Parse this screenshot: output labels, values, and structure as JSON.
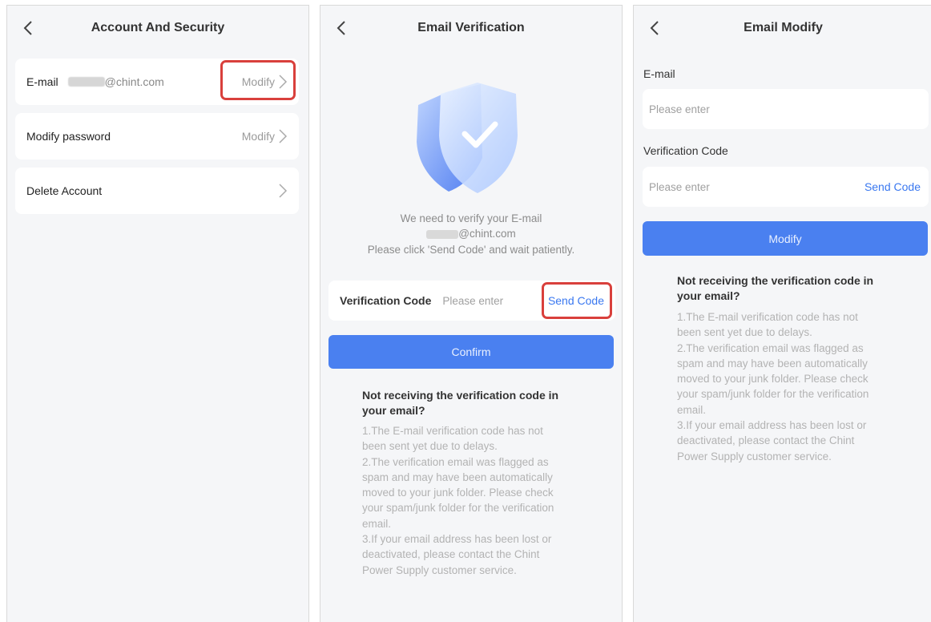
{
  "panel1": {
    "title": "Account And Security",
    "rows": [
      {
        "label": "E-mail",
        "value": "@chint.com",
        "action": "Modify"
      },
      {
        "label": "Modify password",
        "action": "Modify"
      },
      {
        "label": "Delete Account",
        "action": ""
      }
    ]
  },
  "panel2": {
    "title": "Email Verification",
    "message_line1": "We need to verify your E-mail",
    "message_line2": "@chint.com",
    "message_line3": "Please click 'Send Code' and wait patiently.",
    "code_label": "Verification Code",
    "code_placeholder": "Please enter",
    "send_code": "Send Code",
    "confirm": "Confirm",
    "help_title_1": "Not receiving the verification code in",
    "help_title_2": "your email?",
    "help_lines": [
      "1.The E-mail verification code has not",
      "been sent yet due to delays.",
      "2.The verification email was flagged as",
      "spam and may have been automatically",
      "moved to your junk folder. Please check",
      "your spam/junk folder for the verification",
      "email.",
      "3.If your email address has been lost or",
      "deactivated, please contact the Chint",
      "Power Supply customer service."
    ]
  },
  "panel3": {
    "title": "Email Modify",
    "email_label": "E-mail",
    "email_placeholder": "Please enter",
    "code_label": "Verification Code",
    "code_placeholder": "Please enter",
    "send_code": "Send Code",
    "modify": "Modify",
    "help_title_1": "Not receiving the verification code in",
    "help_title_2": "your email?",
    "help_lines": [
      "1.The E-mail verification code has not",
      "been sent yet due to delays.",
      "2.The verification email was flagged as",
      "spam and may have been automatically",
      "moved to your junk folder. Please check",
      "your spam/junk folder for the verification",
      "email.",
      "3.If your email address has been lost or",
      "deactivated, please contact the Chint",
      "Power Supply customer service."
    ]
  },
  "colors": {
    "accent": "#4a80f0",
    "link": "#3a78f0",
    "highlight": "#d9403c",
    "background": "#f5f6f8"
  }
}
